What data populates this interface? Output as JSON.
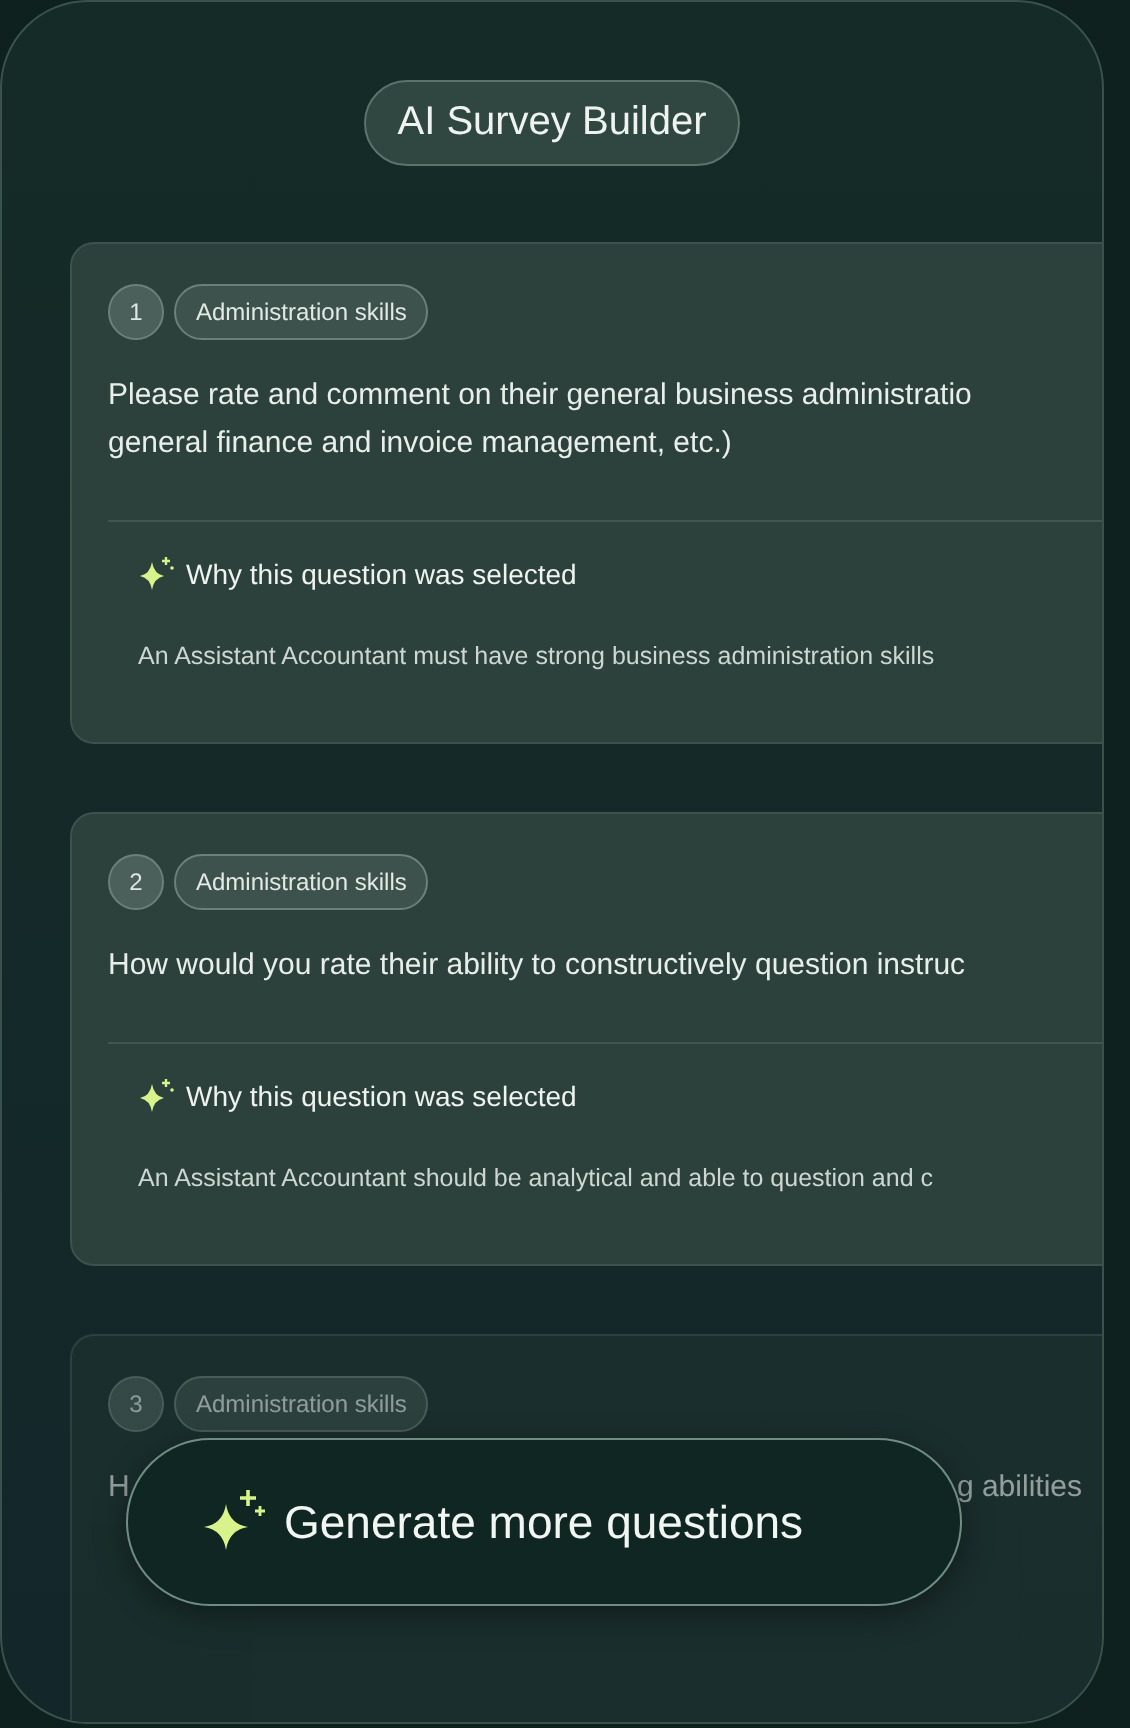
{
  "title": "AI Survey Builder",
  "questions": [
    {
      "number": "1",
      "tag": "Administration skills",
      "faded": false,
      "question_lines": [
        "Please rate and comment on their general business administratio",
        "general finance and invoice management, etc.)"
      ],
      "why_heading": "Why this question was selected",
      "why_text": "An Assistant Accountant must have strong business administration skills"
    },
    {
      "number": "2",
      "tag": "Administration skills",
      "faded": false,
      "question_lines": [
        "How would you rate their ability to constructively question instruc"
      ],
      "why_heading": "Why this question was selected",
      "why_text": "An Assistant Accountant should be analytical and able to question and c"
    },
    {
      "number": "3",
      "tag": "Administration skills",
      "faded": true,
      "question_fragments": [
        "H",
        "g abilities"
      ]
    }
  ],
  "generate_button": "Generate more questions"
}
